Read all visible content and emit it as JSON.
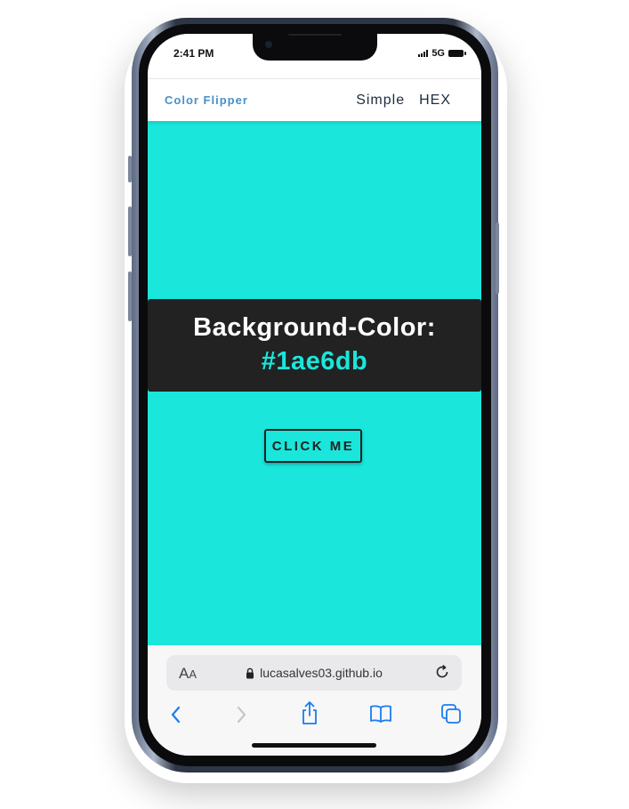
{
  "status_bar": {
    "time": "2:41 PM",
    "network": "5G"
  },
  "navbar": {
    "brand": "Color Flipper",
    "links": [
      "Simple",
      "HEX"
    ]
  },
  "main": {
    "background_color": "#1ae6db",
    "label": "Background-Color:",
    "color_value": "#1ae6db",
    "button_label": "CLICK ME"
  },
  "browser": {
    "text_size_label_large": "A",
    "text_size_label_small": "A",
    "url": "lucasalves03.github.io"
  },
  "toolbar": {
    "icons": [
      "back-icon",
      "forward-icon",
      "share-icon",
      "bookmarks-icon",
      "tabs-icon"
    ]
  },
  "colors": {
    "accent": "#1ae6db",
    "brand": "#4a90c8",
    "panel": "#222222",
    "ios_blue": "#1a7cf0"
  }
}
